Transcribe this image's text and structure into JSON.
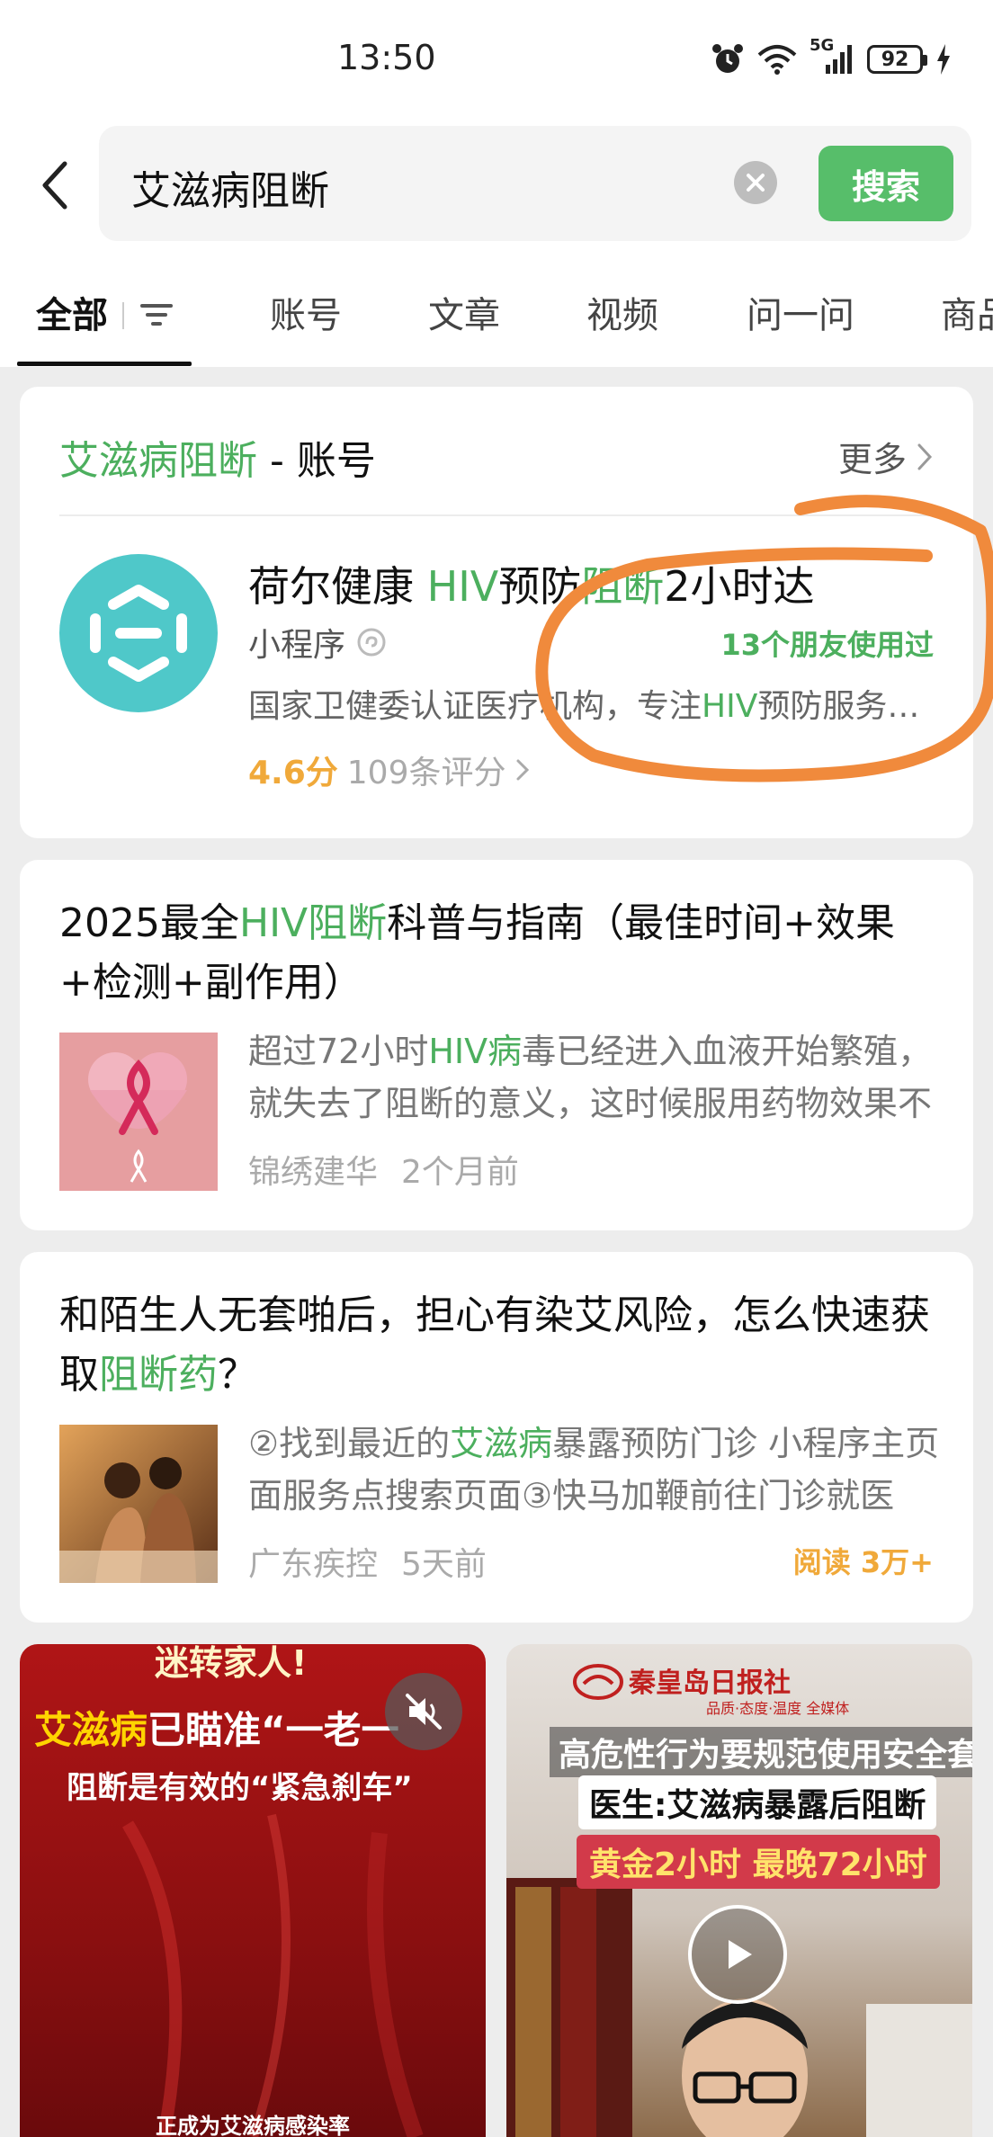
{
  "status_bar": {
    "time": "13:50",
    "network": "5G",
    "battery": "92"
  },
  "search": {
    "query": "艾滋病阻断",
    "button_label": "搜索"
  },
  "tabs": [
    {
      "label": "全部",
      "active": true
    },
    {
      "label": "账号"
    },
    {
      "label": "文章"
    },
    {
      "label": "视频"
    },
    {
      "label": "问一问"
    },
    {
      "label": "商品"
    }
  ],
  "account_section": {
    "keyword": "艾滋病阻断",
    "heading_suffix": " - 账号",
    "more_label": "更多",
    "item": {
      "title_a": "荷尔健康 ",
      "title_hl1": "HIV",
      "title_b": "预防",
      "title_hl2": "阻断",
      "title_c": "2小时达",
      "type": "小程序",
      "friends_used": "13个朋友使用过",
      "desc_a": "国家卫健委认证医疗机构，专注",
      "desc_hl": "HIV",
      "desc_b": "预防服务，提供专业的阻断用药与检测服务",
      "score": "4.6分",
      "reviews": "109条评分"
    }
  },
  "articles": [
    {
      "title_a": "2025最全",
      "title_hl": "HIV阻断",
      "title_b": "科普与指南（最佳时间+效果+检测+副作用）",
      "desc_a": "超过72小时",
      "desc_hl": "HIV病",
      "desc_b": "毒已经进入血液开始繁殖，就失去了阻断的意义，这时候服用药物效果不佳",
      "source": "锦绣建华",
      "time": "2个月前"
    },
    {
      "title_a": "和陌生人无套啪后，担心有染艾风险，怎么快速获取",
      "title_hl": "阻断药",
      "title_b": "？",
      "desc_a": "②找到最近的",
      "desc_hl": "艾滋病",
      "desc_b": "暴露预防门诊 小程序主页面服务点搜索页面③快马加鞭前往门诊就医",
      "source": "广东疾控",
      "time": "5天前",
      "reads": "阅读 3万+"
    }
  ],
  "videos": [
    {
      "top_text": "迷转家人!",
      "line1_hl": "艾滋病",
      "line1_rest": "已瞄准“一老一",
      "line2": "阻断是有效的“紧急刹车”",
      "bottom_text": "正成为艾滋病感染率"
    },
    {
      "logo": "秦皇岛日报社",
      "logo_sub": "品质·态度·温度  全媒体",
      "line1": "高危性行为要规范使用安全套",
      "line2": "医生:艾滋病暴露后阻断",
      "line3": "黄金2小时 最晚72小时"
    }
  ],
  "colors": {
    "accent_green": "#57be6a",
    "highlight_green": "#4caf5e",
    "rating_orange": "#f0a93a",
    "annotation_orange": "#f08a3c"
  }
}
